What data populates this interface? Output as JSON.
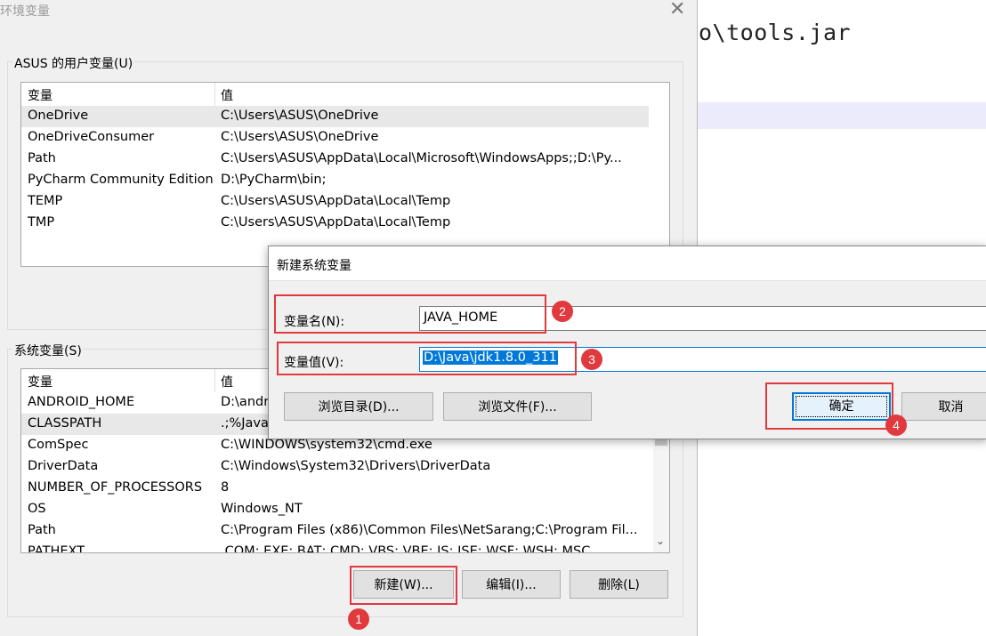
{
  "background": {
    "code_line": "o\\tools.jar"
  },
  "env_dialog": {
    "title": "环境变量",
    "close_icon": "close-icon",
    "user_group_label": "ASUS 的用户变量(U)",
    "system_group_label": "系统变量(S)",
    "columns": [
      "变量",
      "值"
    ],
    "user_vars": [
      {
        "name": "OneDrive",
        "value": "C:\\Users\\ASUS\\OneDrive"
      },
      {
        "name": "OneDriveConsumer",
        "value": "C:\\Users\\ASUS\\OneDrive"
      },
      {
        "name": "Path",
        "value": "C:\\Users\\ASUS\\AppData\\Local\\Microsoft\\WindowsApps;;D:\\Py..."
      },
      {
        "name": "PyCharm Community Edition",
        "value": "D:\\PyCharm\\bin;"
      },
      {
        "name": "TEMP",
        "value": "C:\\Users\\ASUS\\AppData\\Local\\Temp"
      },
      {
        "name": "TMP",
        "value": "C:\\Users\\ASUS\\AppData\\Local\\Temp"
      }
    ],
    "system_vars": [
      {
        "name": "ANDROID_HOME",
        "value": "D:\\andr"
      },
      {
        "name": "CLASSPATH",
        "value": ".;%Java_"
      },
      {
        "name": "ComSpec",
        "value": "C:\\WINDOWS\\system32\\cmd.exe"
      },
      {
        "name": "DriverData",
        "value": "C:\\Windows\\System32\\Drivers\\DriverData"
      },
      {
        "name": "NUMBER_OF_PROCESSORS",
        "value": "8"
      },
      {
        "name": "OS",
        "value": "Windows_NT"
      },
      {
        "name": "Path",
        "value": "C:\\Program Files (x86)\\Common Files\\NetSarang;C:\\Program Fil..."
      },
      {
        "name": "PATHEXT",
        "value": ".COM;.EXE;.BAT;.CMD;.VBS;.VBE;.JS;.JSE;.WSF;.WSH;.MSC"
      }
    ],
    "buttons": {
      "new": "新建(W)...",
      "edit": "编辑(I)...",
      "delete": "删除(L)"
    }
  },
  "new_var_dialog": {
    "title": "新建系统变量",
    "name_label": "变量名(N):",
    "name_value": "JAVA_HOME",
    "value_label": "变量值(V):",
    "value_value": "D:\\Java\\jdk1.8.0_311",
    "browse_dir": "浏览目录(D)...",
    "browse_file": "浏览文件(F)...",
    "ok": "确定",
    "cancel": "取消"
  },
  "annotations": {
    "badge1": "1",
    "badge2": "2",
    "badge3": "3",
    "badge4": "4",
    "color": "#e0393e"
  },
  "colors": {
    "accent": "#0078d7",
    "dialog_bg": "#f0f0f0"
  }
}
